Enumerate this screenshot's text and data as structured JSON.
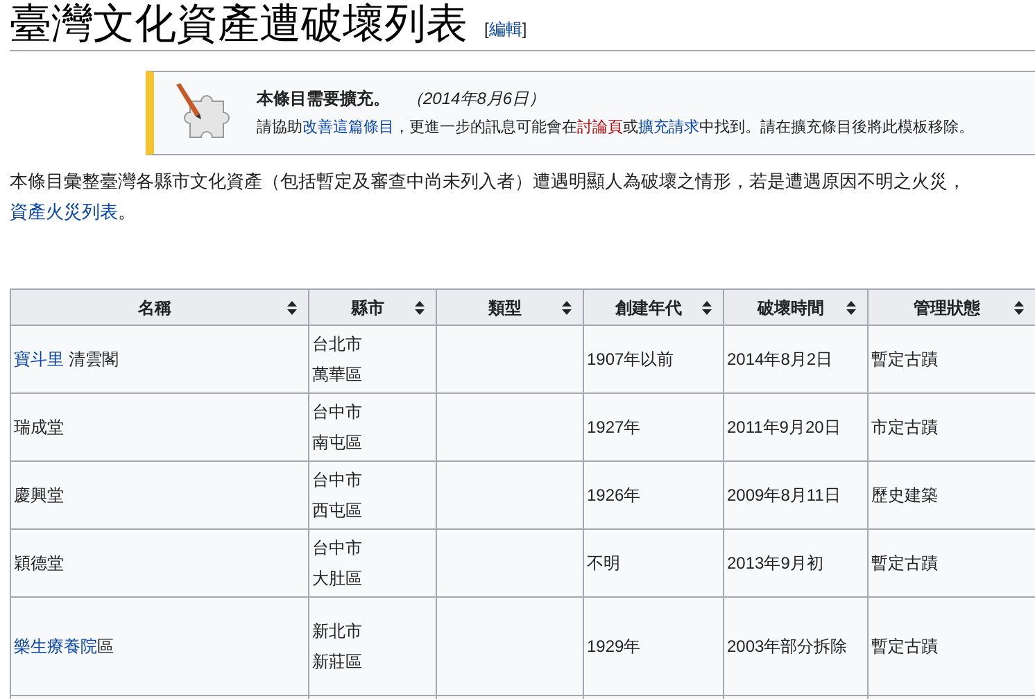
{
  "page_title": "臺灣文化資產遭破壞列表",
  "edit_link": {
    "open": "[",
    "label": "編輯",
    "close": "]"
  },
  "notice": {
    "title": "本條目需要擴充。",
    "date": "（2014年8月6日）",
    "body": [
      {
        "text": "請協助",
        "kind": "plain"
      },
      {
        "text": "改善這篇條目",
        "kind": "link"
      },
      {
        "text": "，更進一步的訊息可能會在",
        "kind": "plain"
      },
      {
        "text": "討論頁",
        "kind": "redlink"
      },
      {
        "text": "或",
        "kind": "plain"
      },
      {
        "text": "擴充請求",
        "kind": "link"
      },
      {
        "text": "中找到。請在擴充條目後將此模板移除。",
        "kind": "plain"
      }
    ]
  },
  "intro": [
    [
      {
        "text": "本條目彙整臺灣各縣市文化資產（包括暫定及審查中尚未列入者）遭遇明顯人為破壞之情形，若是遭遇原因不明之火災，",
        "kind": "plain"
      }
    ],
    [
      {
        "text": "資產火災列表",
        "kind": "link"
      },
      {
        "text": "。",
        "kind": "plain"
      }
    ]
  ],
  "table": {
    "columns": [
      "名稱",
      "縣市",
      "類型",
      "創建年代",
      "破壞時間",
      "管理狀態"
    ],
    "rows": [
      {
        "name": [
          {
            "text": "寶斗里",
            "kind": "link"
          },
          {
            "text": " 清雲閣",
            "kind": "plain"
          }
        ],
        "city": [
          "台北市",
          "萬華區"
        ],
        "type": "",
        "built": "1907年以前",
        "destroyed": "2014年8月2日",
        "status": "暫定古蹟"
      },
      {
        "name": [
          {
            "text": "瑞成堂",
            "kind": "plain"
          }
        ],
        "city": [
          "台中市",
          "南屯區"
        ],
        "type": "",
        "built": "1927年",
        "destroyed": "2011年9月20日",
        "status": "市定古蹟"
      },
      {
        "name": [
          {
            "text": "慶興堂",
            "kind": "plain"
          }
        ],
        "city": [
          "台中市",
          "西屯區"
        ],
        "type": "",
        "built": "1926年",
        "destroyed": "2009年8月11日",
        "status": "歷史建築"
      },
      {
        "name": [
          {
            "text": "穎德堂",
            "kind": "plain"
          }
        ],
        "city": [
          "台中市",
          "大肚區"
        ],
        "type": "",
        "built": "不明",
        "destroyed": "2013年9月初",
        "status": "暫定古蹟"
      },
      {
        "name": [
          {
            "text": "樂生療養院",
            "kind": "link"
          },
          {
            "text": "區",
            "kind": "plain"
          }
        ],
        "city": [
          "新北市",
          "新莊區"
        ],
        "type": "",
        "built": "1929年",
        "destroyed": "2003年部分拆除",
        "status": "暫定古蹟"
      }
    ]
  }
}
